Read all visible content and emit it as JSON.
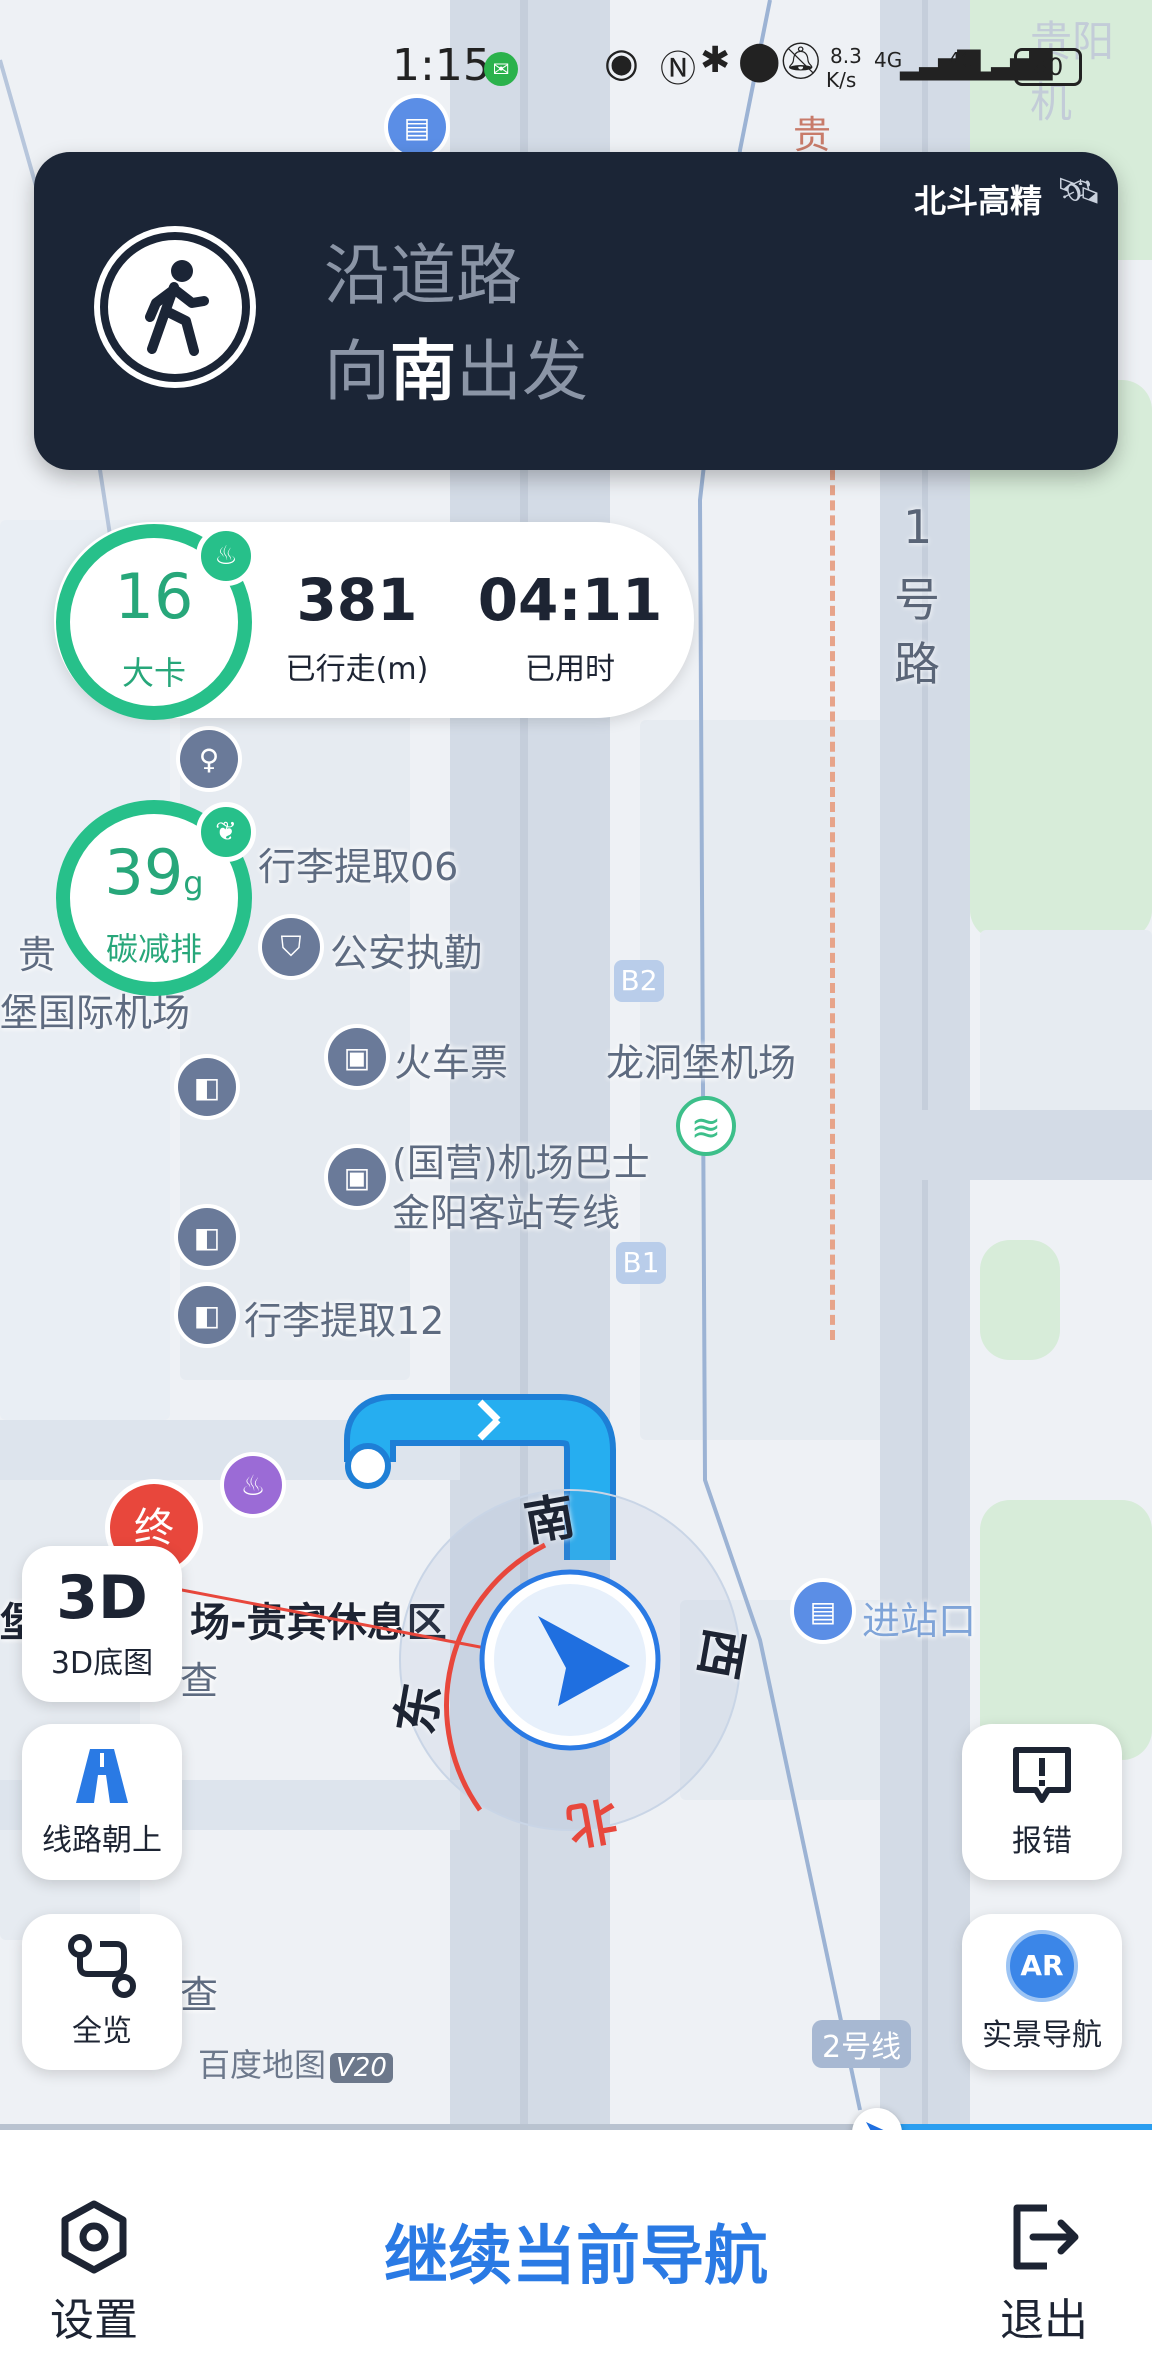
{
  "status_bar": {
    "time": "1:15",
    "net_speed_top": "8.3",
    "net_speed_bottom": "K/s",
    "net1": "4G",
    "net2": "4G",
    "battery": "80"
  },
  "nav_card": {
    "gps_label": "北斗高精",
    "line1": "沿道路",
    "line2_prefix": "向",
    "line2_dir": "南",
    "line2_suffix": "出发",
    "mode_icon": "walking-person-icon"
  },
  "stats": {
    "calories_value": "16",
    "calories_unit": "大卡",
    "distance_value": "381",
    "distance_label": "已行走(m)",
    "time_value": "04:11",
    "time_label": "已用时",
    "carbon_value": "39",
    "carbon_unit": "g",
    "carbon_label": "碳减排"
  },
  "map": {
    "top_right_label": "贵阳机",
    "top_label": "贵",
    "road_label_chars": [
      "1",
      "号",
      "路"
    ],
    "labels": {
      "luggage06": "行李提取06",
      "police": "公安执勤",
      "gui": "贵",
      "intl": "堡国际机场",
      "train": "火车票",
      "airport": "龙洞堡机场",
      "bus_line1": "(国营)机场巴士",
      "bus_line2": "金阳客站专线",
      "luggage12": "行李提取12",
      "b1": "B1",
      "b2": "B2",
      "end": "终",
      "vip_prefix": "堡",
      "vip": "场-贵宾休息区",
      "cha1": "查",
      "cha2": "查",
      "entrance": "进站口",
      "line2": "2号线",
      "watermark": "百度地图",
      "watermark_ver": "V20"
    },
    "compass": {
      "south": "南",
      "west": "西",
      "east": "东",
      "north": "北"
    }
  },
  "side_buttons": {
    "view3d_icon_text": "3D",
    "view3d_label": "3D底图",
    "route_up_label": "线路朝上",
    "overview_label": "全览",
    "report_label": "报错",
    "ar_icon_text": "AR",
    "ar_label": "实景导航"
  },
  "bottom": {
    "settings_label": "设置",
    "continue_label": "继续当前导航",
    "exit_label": "退出"
  },
  "colors": {
    "accent_blue": "#2a7ae4",
    "green": "#27c08a",
    "nav_card_bg": "#1b2536",
    "route_blue": "#1fa6e8"
  }
}
